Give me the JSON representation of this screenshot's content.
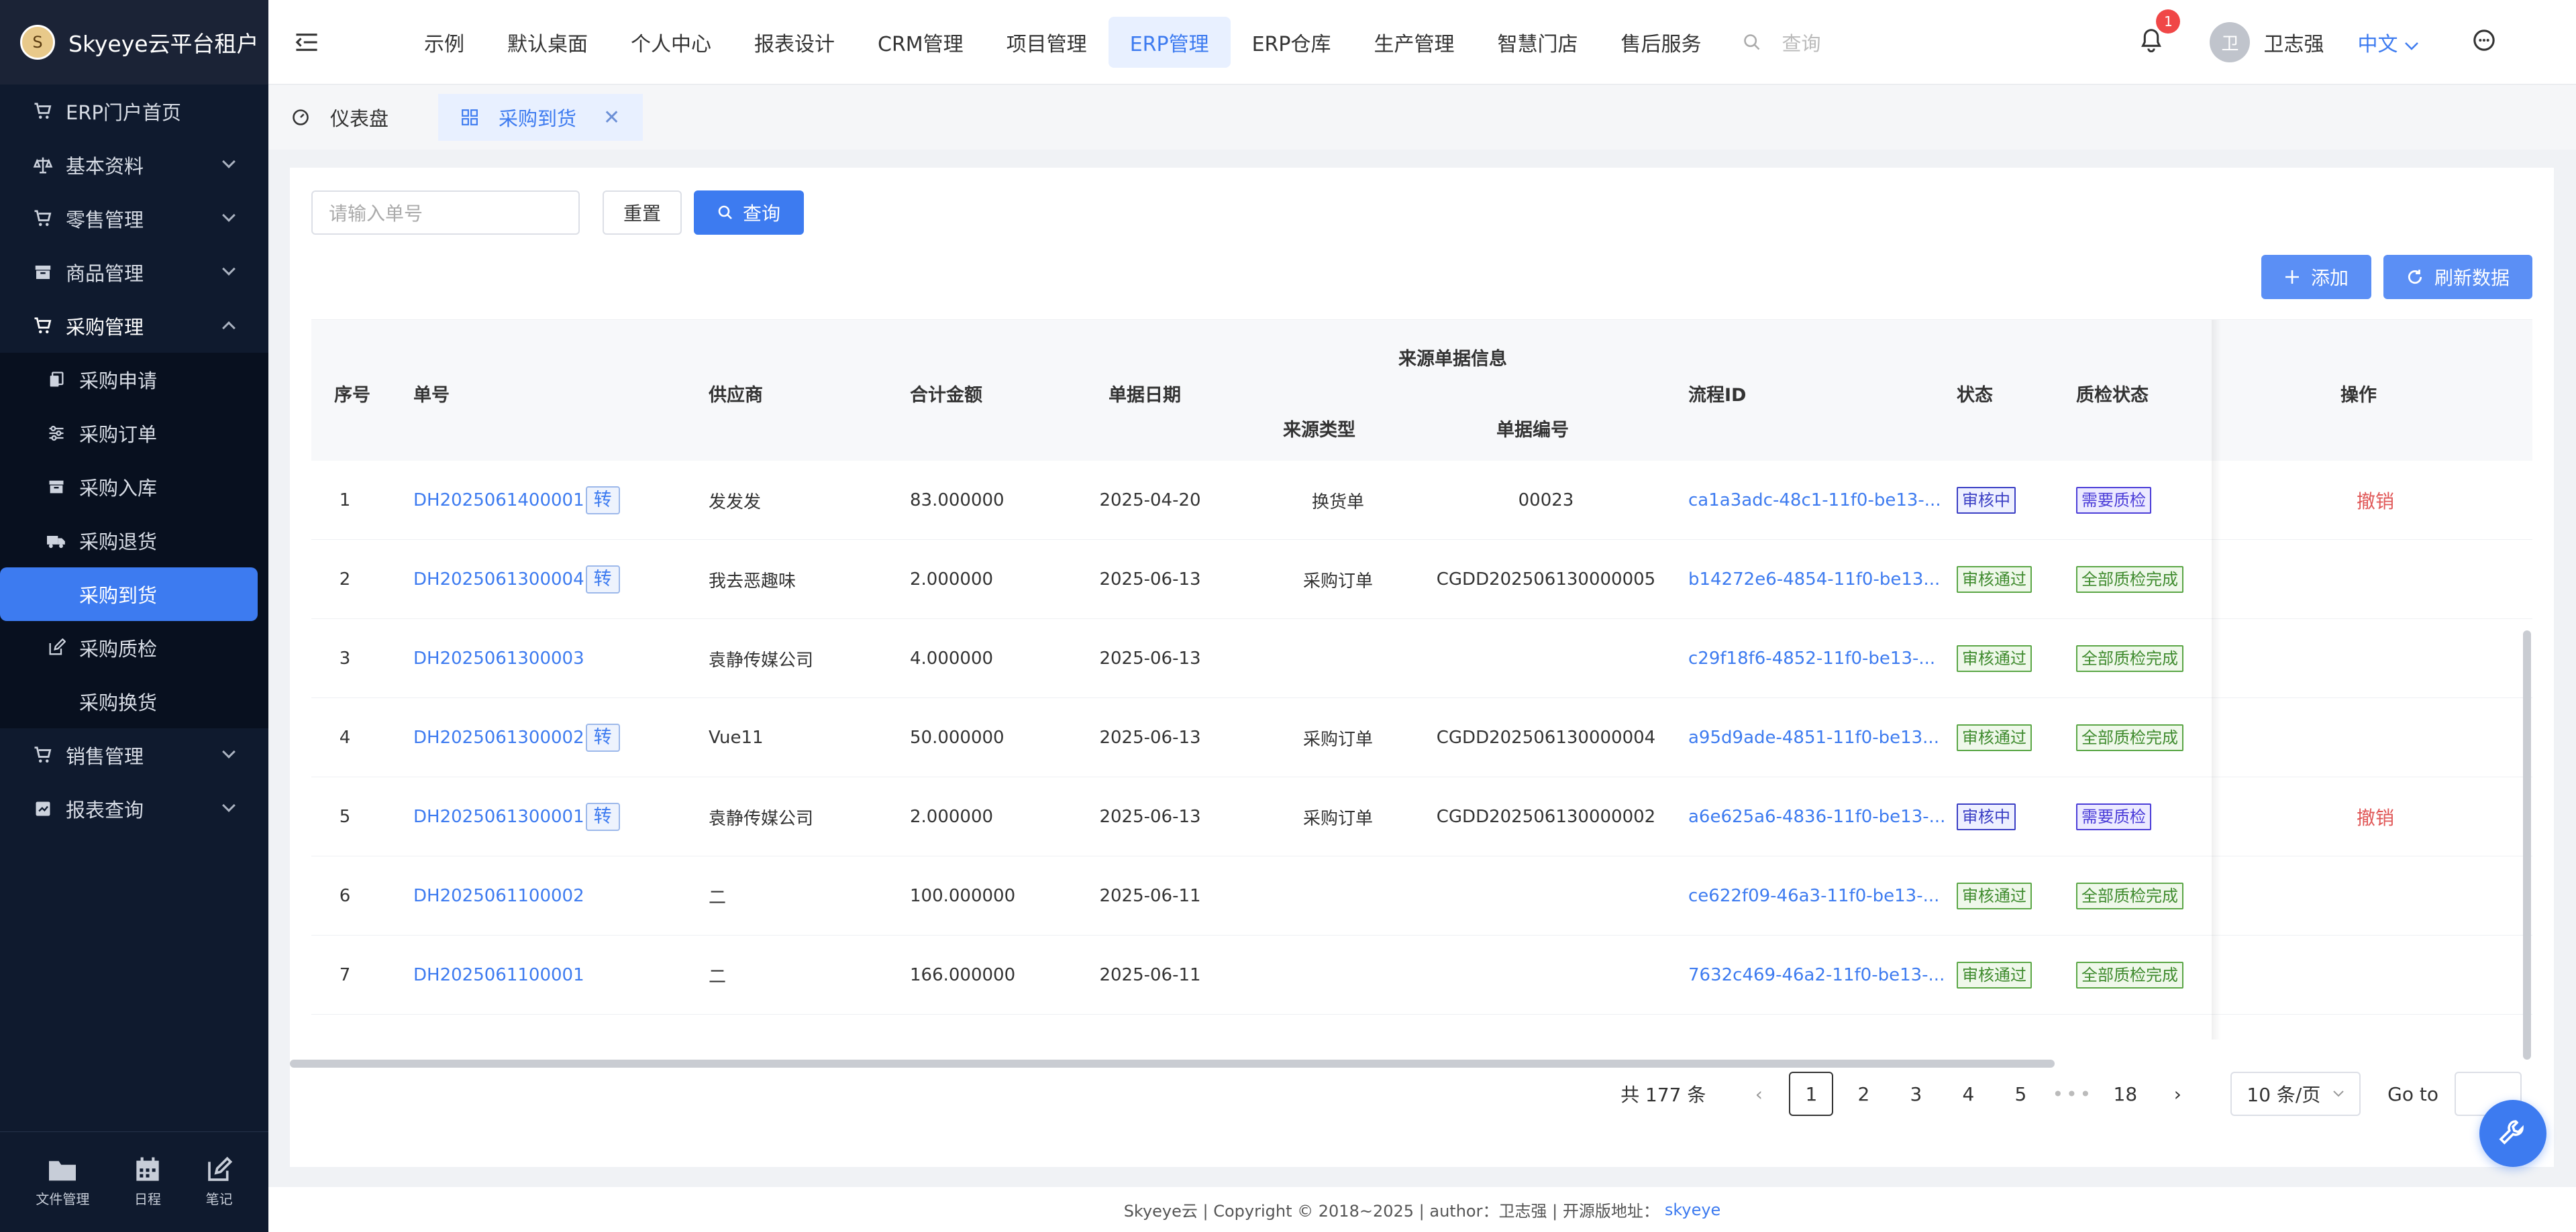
{
  "app": {
    "title": "Skyeye云平台租户",
    "logo_char": "S"
  },
  "sidebar": {
    "items": [
      {
        "label": "ERP门户首页",
        "icon": "cart-icon"
      },
      {
        "label": "基本资料",
        "icon": "scale-icon"
      },
      {
        "label": "零售管理",
        "icon": "cart-icon"
      },
      {
        "label": "商品管理",
        "icon": "box-icon"
      },
      {
        "label": "采购管理",
        "icon": "cart-icon"
      }
    ],
    "purchase_sub": [
      {
        "label": "采购申请"
      },
      {
        "label": "采购订单"
      },
      {
        "label": "采购入库"
      },
      {
        "label": "采购退货"
      },
      {
        "label": "采购到货"
      },
      {
        "label": "采购质检"
      },
      {
        "label": "采购换货"
      }
    ],
    "more_items": [
      {
        "label": "销售管理"
      },
      {
        "label": "报表查询"
      }
    ],
    "bottom": [
      {
        "label": "文件管理"
      },
      {
        "label": "日程"
      },
      {
        "label": "笔记"
      }
    ]
  },
  "topnav": {
    "tabs": [
      "示例",
      "默认桌面",
      "个人中心",
      "报表设计",
      "CRM管理",
      "项目管理",
      "ERP管理",
      "ERP仓库",
      "生产管理",
      "智慧门店",
      "售后服务"
    ],
    "active_index": 6,
    "search_placeholder": "查询",
    "notification_count": "1",
    "avatar_char": "卫",
    "user_name": "卫志强",
    "language": "中文"
  },
  "tags": {
    "dashboard": "仪表盘",
    "current": "采购到货"
  },
  "filter": {
    "placeholder": "请输入单号",
    "reset": "重置",
    "query": "查询"
  },
  "actions": {
    "add": "添加",
    "refresh": "刷新数据"
  },
  "table": {
    "headers": {
      "index": "序号",
      "order_no": "单号",
      "supplier": "供应商",
      "amount": "合计金额",
      "date": "单据日期",
      "source_group": "来源单据信息",
      "source_type": "来源类型",
      "source_no": "单据编号",
      "process_id": "流程ID",
      "status": "状态",
      "qc_status": "质检状态",
      "operation": "操作"
    },
    "transfer_label": "转",
    "rows": [
      {
        "index": "1",
        "order_no": "DH2025061400001",
        "transfer": true,
        "supplier": "发发发",
        "amount": "83.000000",
        "date": "2025-04-20",
        "source_type": "换货单",
        "source_no": "00023",
        "process_id": "ca1a3adc-48c1-11f0-be13-...",
        "status": "审核中",
        "status_color": "blue",
        "qc": "需要质检",
        "qc_color": "purple",
        "op": "撤销"
      },
      {
        "index": "2",
        "order_no": "DH2025061300004",
        "transfer": true,
        "supplier": "我去恶趣味",
        "amount": "2.000000",
        "date": "2025-06-13",
        "source_type": "采购订单",
        "source_no": "CGDD202506130000005",
        "process_id": "b14272e6-4854-11f0-be13...",
        "status": "审核通过",
        "status_color": "green",
        "qc": "全部质检完成",
        "qc_color": "green",
        "op": ""
      },
      {
        "index": "3",
        "order_no": "DH2025061300003",
        "transfer": false,
        "supplier": "袁静传媒公司",
        "amount": "4.000000",
        "date": "2025-06-13",
        "source_type": "",
        "source_no": "",
        "process_id": "c29f18f6-4852-11f0-be13-...",
        "status": "审核通过",
        "status_color": "green",
        "qc": "全部质检完成",
        "qc_color": "green",
        "op": ""
      },
      {
        "index": "4",
        "order_no": "DH2025061300002",
        "transfer": true,
        "supplier": "Vue11",
        "amount": "50.000000",
        "date": "2025-06-13",
        "source_type": "采购订单",
        "source_no": "CGDD202506130000004",
        "process_id": "a95d9ade-4851-11f0-be13...",
        "status": "审核通过",
        "status_color": "green",
        "qc": "全部质检完成",
        "qc_color": "green",
        "op": ""
      },
      {
        "index": "5",
        "order_no": "DH2025061300001",
        "transfer": true,
        "supplier": "袁静传媒公司",
        "amount": "2.000000",
        "date": "2025-06-13",
        "source_type": "采购订单",
        "source_no": "CGDD202506130000002",
        "process_id": "a6e625a6-4836-11f0-be13-...",
        "status": "审核中",
        "status_color": "blue",
        "qc": "需要质检",
        "qc_color": "purple",
        "op": "撤销"
      },
      {
        "index": "6",
        "order_no": "DH2025061100002",
        "transfer": false,
        "supplier": "二",
        "amount": "100.000000",
        "date": "2025-06-11",
        "source_type": "",
        "source_no": "",
        "process_id": "ce622f09-46a3-11f0-be13-...",
        "status": "审核通过",
        "status_color": "green",
        "qc": "全部质检完成",
        "qc_color": "green",
        "op": ""
      },
      {
        "index": "7",
        "order_no": "DH2025061100001",
        "transfer": false,
        "supplier": "二",
        "amount": "166.000000",
        "date": "2025-06-11",
        "source_type": "",
        "source_no": "",
        "process_id": "7632c469-46a2-11f0-be13-...",
        "status": "审核通过",
        "status_color": "green",
        "qc": "全部质检完成",
        "qc_color": "green",
        "op": ""
      }
    ]
  },
  "pagination": {
    "total": "共 177 条",
    "pages": [
      "1",
      "2",
      "3",
      "4",
      "5"
    ],
    "dots": "•••",
    "last": "18",
    "page_size": "10 条/页",
    "goto": "Go to"
  },
  "footer": {
    "text": "Skyeye云 | Copyright © 2018~2025 | author：卫志强 | 开源版地址：",
    "link": "skyeye"
  },
  "colors": {
    "accent": "#3d7bf0",
    "sidebar_bg": "#0f1a2e",
    "danger": "#e05757"
  }
}
